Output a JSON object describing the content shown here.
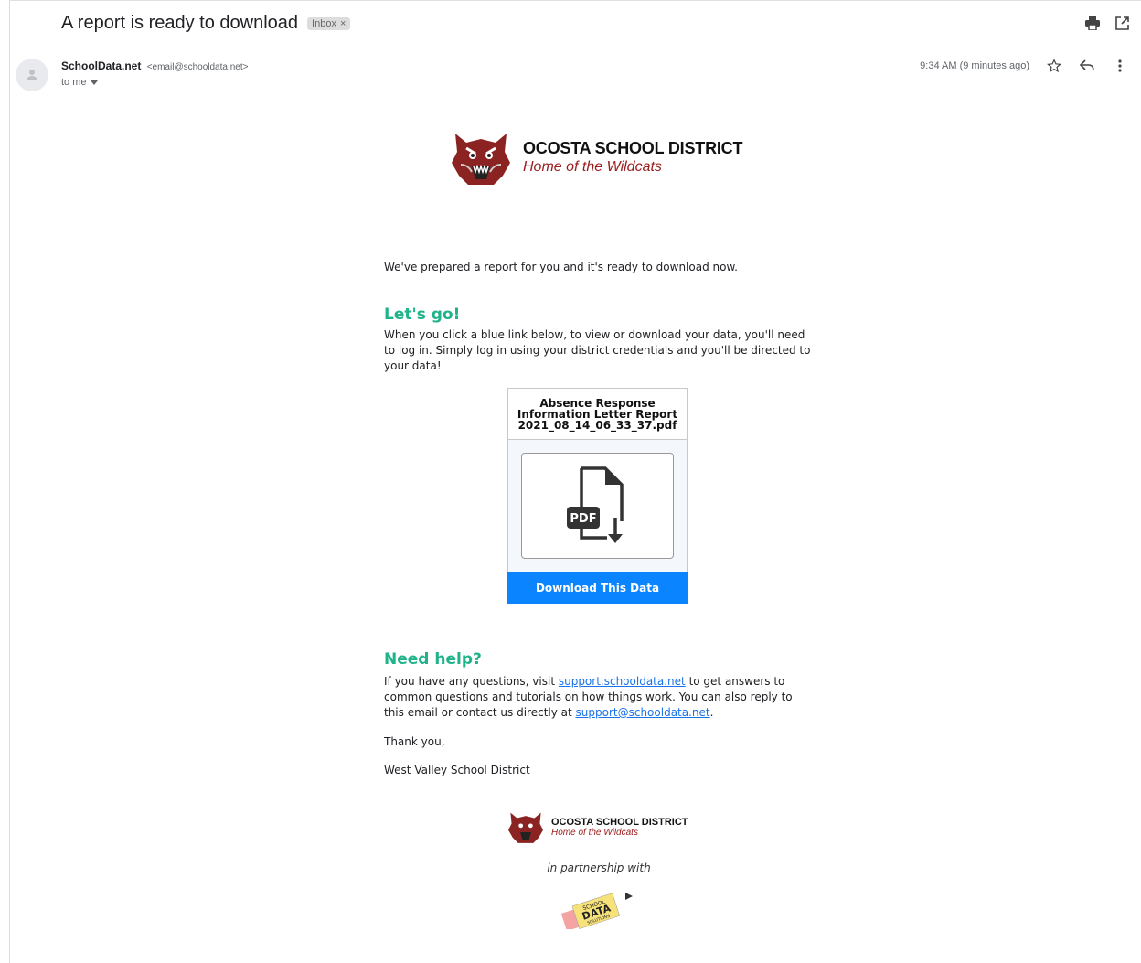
{
  "email": {
    "subject": "A report is ready to download",
    "label": "Inbox",
    "sender_name": "SchoolData.net",
    "sender_email": "<email@schooldata.net>",
    "to": "to me",
    "time": "9:34 AM (9 minutes ago)"
  },
  "header_icons": [
    "print-icon",
    "open-in-new-icon"
  ],
  "action_icons": [
    "star-icon",
    "reply-icon",
    "more-vert-icon"
  ],
  "body": {
    "logo_title": "OCOSTA SCHOOL DISTRICT",
    "logo_subtitle": "Home of the Wildcats",
    "intro": "We've prepared a report for you and it's ready to download now.",
    "lets_go_title": "Let's go!",
    "lets_go_text": "When you click a blue link below, to view or download your data, you'll need to log in. Simply log in using your district credentials and you'll be directed to your data!",
    "card": {
      "title_line1": "Absence Response",
      "title_line2": "Information Letter Report",
      "title_line3": "2021_08_14_06_33_37.pdf",
      "pdf_badge": "PDF",
      "button": "Download This Data"
    },
    "help_title": "Need help?",
    "help_text_1": "If you have any questions, visit ",
    "help_link_1": "support.schooldata.net",
    "help_text_2": " to get answers to common questions and tutorials on how things work. You can also reply to this email or contact us directly at ",
    "help_link_2": "support@schooldata.net",
    "help_text_3": ".",
    "thanks": "Thank you,",
    "signature": "West Valley School District",
    "footer_title": "OCOSTA SCHOOL DISTRICT",
    "footer_subtitle": "Home of the Wildcats",
    "partnership": "in partnership with",
    "partner_logo_line1": "SCHOOL",
    "partner_logo_line2": "DATA",
    "partner_logo_line3": "SOLUTIONS"
  },
  "colors": {
    "accent_green": "#1fb38a",
    "button_blue": "#0a84ff",
    "district_red": "#9b1c1c",
    "link_blue": "#1a73e8"
  }
}
